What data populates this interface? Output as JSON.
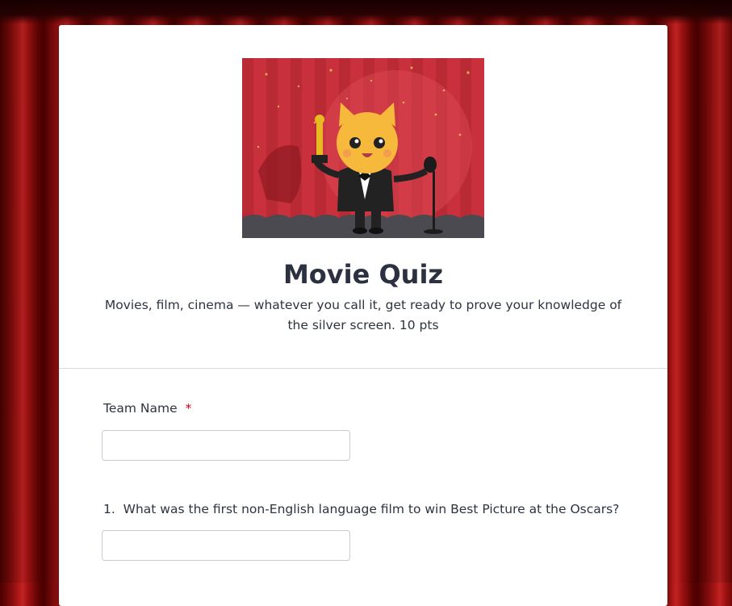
{
  "colors": {
    "curtain": "#a81616",
    "card": "#ffffff",
    "title": "#2b3140",
    "required": "#d0021b",
    "hero_bg": "#c8313b"
  },
  "hero_image": {
    "icon": "cat-with-oscar-trophy-illustration"
  },
  "form": {
    "title": "Movie Quiz",
    "description": "Movies, film, cinema — whatever you call it, get ready to prove your knowledge of the silver screen. 10 pts"
  },
  "questions": [
    {
      "label": "Team Name",
      "required_marker": "*",
      "value": "",
      "placeholder": ""
    },
    {
      "number": "1.",
      "label": "What was the first non-English language film to win Best Picture at the Oscars?",
      "value": "",
      "placeholder": ""
    }
  ]
}
